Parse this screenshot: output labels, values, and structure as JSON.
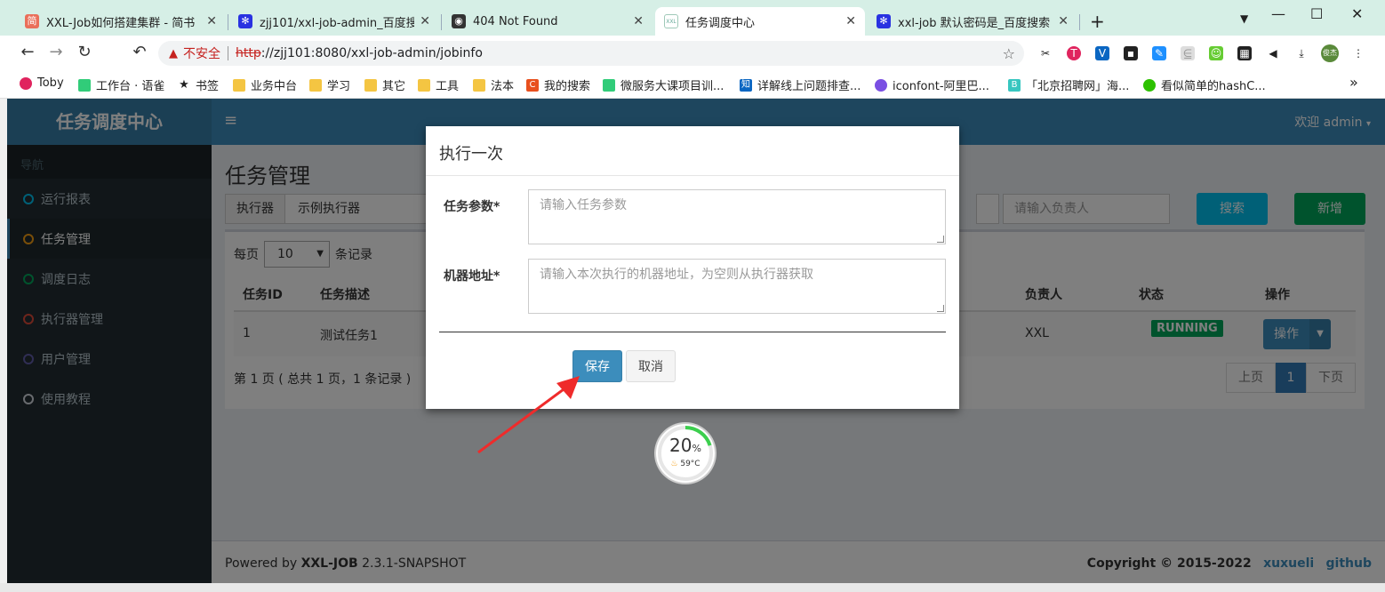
{
  "browser": {
    "tabs": [
      {
        "label": "XXL-Job如何搭建集群 - 简书",
        "icon": "jianshu-icon",
        "icon_char": "简",
        "icon_color": "#ea6f5a"
      },
      {
        "label": "zjj101/xxl-job-admin_百度搜",
        "icon": "baidu-paw-icon",
        "icon_char": "✻",
        "icon_color": "#2932e1"
      },
      {
        "label": "404 Not Found",
        "icon": "globe-icon",
        "icon_char": "◉",
        "icon_color": "#333333"
      },
      {
        "label": "任务调度中心",
        "icon": "xxl-icon",
        "icon_char": "XXL",
        "icon_color": "#9fc9b8",
        "active": true
      },
      {
        "label": "xxl-job 默认密码是_百度搜索",
        "icon": "baidu-paw-icon",
        "icon_char": "✻",
        "icon_color": "#2932e1"
      }
    ],
    "new_tab": "+",
    "address": {
      "warning": "▲",
      "insecure_label": "不安全",
      "protocol": "http",
      "rest": "://zjj101:8080/xxl-job-admin/jobinfo"
    },
    "bookmarks": [
      {
        "label": "Toby",
        "color": "#e0245e"
      },
      {
        "label": "工作台 · 语雀",
        "color": "#31cc79"
      },
      {
        "label": "书签",
        "color": "#222222"
      },
      {
        "label": "业务中台",
        "color": "#f4c542"
      },
      {
        "label": "学习",
        "color": "#f4c542"
      },
      {
        "label": "其它",
        "color": "#f4c542"
      },
      {
        "label": "工具",
        "color": "#f4c542"
      },
      {
        "label": "法本",
        "color": "#f4c542"
      },
      {
        "label": "我的搜索",
        "color": "#e8501e"
      },
      {
        "label": "微服务大课项目训...",
        "color": "#31cc79"
      },
      {
        "label": "详解线上问题排查...",
        "color": "#0a66c2"
      },
      {
        "label": "iconfont-阿里巴...",
        "color": "#7a4fe3"
      },
      {
        "label": "「北京招聘网」海...",
        "color": "#37c6c0"
      },
      {
        "label": "看似简单的hashC...",
        "color": "#2dc100"
      }
    ],
    "bookmarks_more": "»"
  },
  "app": {
    "logo": "任务调度中心",
    "welcome": "欢迎 admin",
    "nav_header": "导航",
    "nav": [
      {
        "label": "运行报表",
        "color": "#00c0ef"
      },
      {
        "label": "任务管理",
        "color": "#f39c12",
        "active": true
      },
      {
        "label": "调度日志",
        "color": "#00a65a"
      },
      {
        "label": "执行器管理",
        "color": "#dd4b39"
      },
      {
        "label": "用户管理",
        "color": "#605ca8"
      },
      {
        "label": "使用教程",
        "color": "#d2d6de"
      }
    ],
    "page_title": "任务管理",
    "filter": {
      "executor_addon": "执行器",
      "executor_value": "示例执行器",
      "owner_placeholder": "请输入负责人",
      "search_label": "搜索",
      "add_label": "新增"
    },
    "table": {
      "per_page_prefix": "每页",
      "per_page_value": "10",
      "per_page_suffix": "条记录",
      "headers": [
        "任务ID",
        "任务描述",
        "负责人",
        "状态",
        "操作"
      ],
      "rows": [
        {
          "id": "1",
          "desc": "测试任务1",
          "owner": "XXL",
          "status": "RUNNING",
          "op": "操作"
        }
      ],
      "page_info": "第 1 页 ( 总共 1 页，1 条记录 )",
      "pager": {
        "prev": "上页",
        "current": "1",
        "next": "下页"
      }
    },
    "footer": {
      "powered_prefix": "Powered by ",
      "powered_name": "XXL-JOB",
      "powered_version": " 2.3.1-SNAPSHOT",
      "copyright": "Copyright © 2015-2022",
      "author": "xuxueli",
      "github": "github"
    }
  },
  "modal": {
    "title": "执行一次",
    "param_label": "任务参数*",
    "param_placeholder": "请输入任务参数",
    "address_label": "机器地址*",
    "address_placeholder": "请输入本次执行的机器地址，为空则从执行器获取",
    "save_label": "保存",
    "cancel_label": "取消"
  },
  "gauge": {
    "percent": "20",
    "unit": "%",
    "temp": "59°C"
  }
}
